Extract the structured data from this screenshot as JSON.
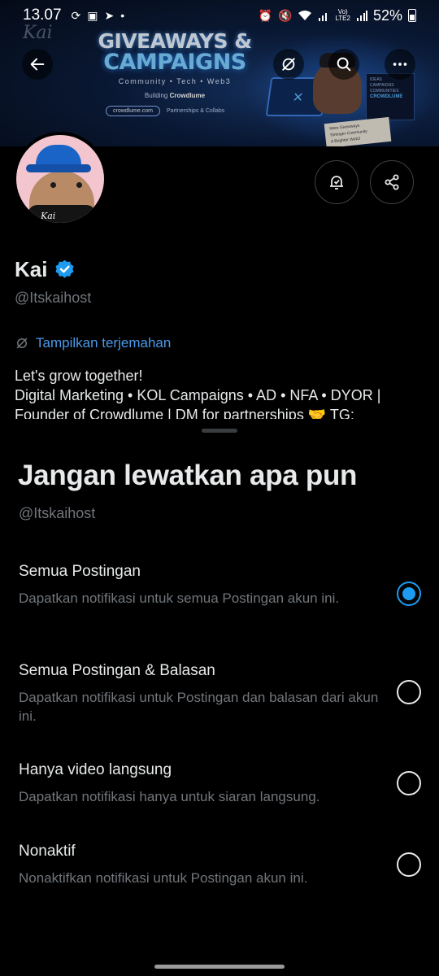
{
  "status_bar": {
    "time": "13.07",
    "battery_percent": "52%",
    "network": "Vo)\nLTE2",
    "icons": [
      "data-saver-icon",
      "gallery-icon",
      "telegram-icon",
      "dot-icon",
      "alarm-icon",
      "mute-icon",
      "wifi-icon",
      "signal-icon",
      "signal-icon-2",
      "battery-icon"
    ]
  },
  "banner": {
    "logo": "Kai",
    "headline_1": "GIVEAWAYS &",
    "headline_2": "CAMPAIGNS",
    "tagline": "Community • Tech • Web3",
    "building_prefix": "Building ",
    "building_name": "Crowdlume",
    "website": "crowdlume.com",
    "partnerships": "Partnerships & Collabs",
    "board_title": "CROWDLUME",
    "board_lines": [
      "IDEAS",
      "CAMPAIGNS",
      "COMMUNITIES"
    ],
    "note_lines": [
      "More Giveaways",
      "Stronger Community",
      "A Brighter Web3"
    ]
  },
  "header_buttons": {
    "back": "back-arrow-icon",
    "translate": "translate-icon",
    "search": "search-icon",
    "more": "more-icon"
  },
  "profile": {
    "avatar_text": "Kai",
    "display_name": "Kai",
    "handle": "@Itskaihost",
    "translate_label": "Tampilkan terjemahan",
    "bio_line_1": "Let's grow together!",
    "bio_line_2": "Digital Marketing • KOL Campaigns • AD • NFA • DYOR |",
    "bio_line_3": "Founder of Crowdlume | DM for partnerships 🤝 TG:"
  },
  "sheet": {
    "title": "Jangan lewatkan apa pun",
    "subtitle": "@Itskaihost",
    "options": [
      {
        "title": "Semua Postingan",
        "description": "Dapatkan notifikasi untuk semua Postingan akun ini.",
        "selected": true
      },
      {
        "title": "Semua Postingan & Balasan",
        "description": "Dapatkan notifikasi untuk Postingan dan balasan dari akun ini.",
        "selected": false
      },
      {
        "title": "Hanya video langsung",
        "description": "Dapatkan notifikasi hanya untuk siaran langsung.",
        "selected": false
      },
      {
        "title": "Nonaktif",
        "description": "Nonaktifkan notifikasi untuk Postingan akun ini.",
        "selected": false
      }
    ]
  },
  "colors": {
    "accent": "#1d9bf0",
    "link": "#4a99e9",
    "background": "#000000",
    "text_primary": "#e7e9ea",
    "text_secondary": "#71767b"
  }
}
